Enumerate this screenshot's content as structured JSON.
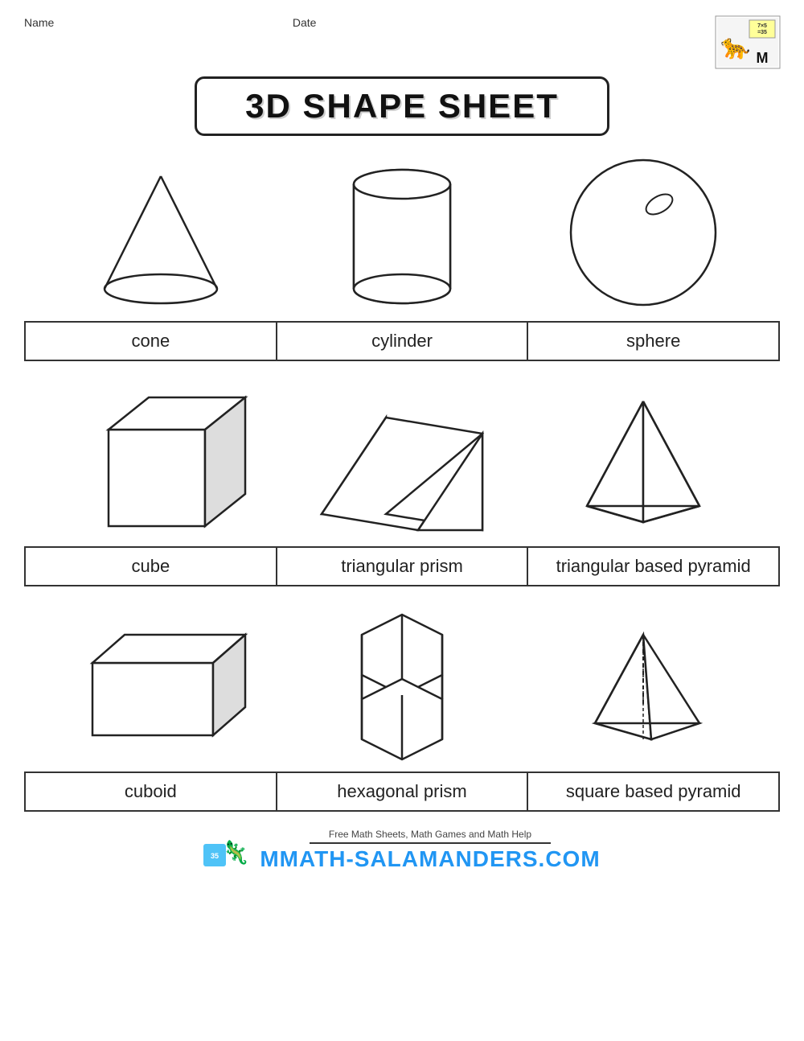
{
  "header": {
    "name_label": "Name",
    "date_label": "Date"
  },
  "title": "3D SHAPE SHEET",
  "rows": [
    {
      "shapes": [
        "cone",
        "cylinder",
        "sphere"
      ],
      "labels": [
        "cone",
        "cylinder",
        "sphere"
      ]
    },
    {
      "shapes": [
        "cube",
        "triangular prism",
        "triangular based pyramid"
      ],
      "labels": [
        "cube",
        "triangular prism",
        "triangular based pyramid"
      ]
    },
    {
      "shapes": [
        "cuboid",
        "hexagonal prism",
        "square based pyramid"
      ],
      "labels": [
        "cuboid",
        "hexagonal prism",
        "square based pyramid"
      ]
    }
  ],
  "footer": {
    "tagline": "Free Math Sheets, Math Games and Math Help",
    "site": "MATH-SALAMANDERS.COM"
  }
}
